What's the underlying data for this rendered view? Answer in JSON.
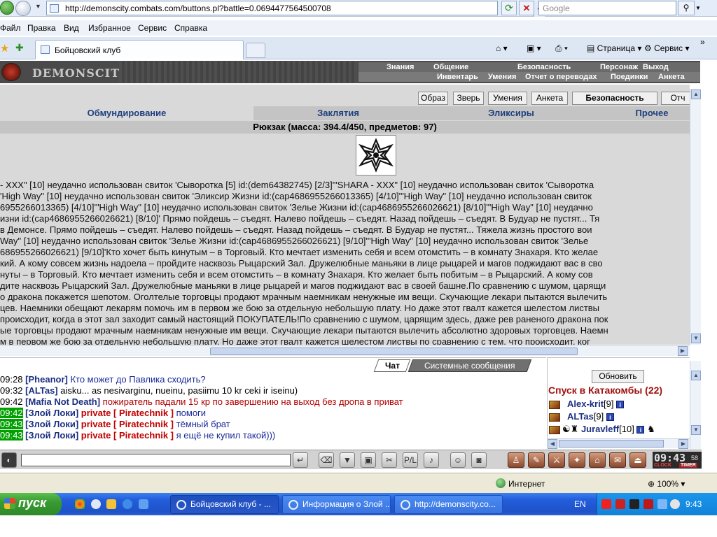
{
  "browser": {
    "url": "http://demonscity.combats.com/buttons.pl?battle=0.0694477564500708",
    "search_placeholder": "Google",
    "menu": [
      "Файл",
      "Правка",
      "Вид",
      "Избранное",
      "Сервис",
      "Справка"
    ],
    "tab_title": "Бойцовский клуб",
    "commands": {
      "page": "Страница",
      "tools": "Сервис"
    },
    "status_zone": "Интернет",
    "zoom": "100%"
  },
  "game": {
    "logo": "DEMONSCITY",
    "nav_top": [
      "Знания",
      "Общение",
      "Безопасность",
      "Персонаж",
      "Выход"
    ],
    "nav_bottom": [
      "Инвентарь",
      "Умения",
      "Отчет о переводах",
      "Поединки",
      "Анкета"
    ],
    "buttons": [
      "Образ",
      "Зверь",
      "Умения",
      "Анкета",
      "Безопасность",
      "Отч"
    ],
    "inventory_tabs": [
      "Обмундирование",
      "Заклятия",
      "Эликсиры",
      "Прочее"
    ],
    "backpack_title": "Рюкзак (масса: 394.4/450, предметов: 97)",
    "log_lines": [
      "- XXX\" [10] неудачно использован свиток 'Сыворотка [5] id:(dem64382745) [2/3]'\"SHARA - XXX\" [10] неудачно использован свиток 'Сыворотка",
      "'High Way\" [10] неудачно использован свиток 'Эликсир Жизни id:(cap4686955266013365) [4/10]'\"High Way\" [10] неудачно использован свиток",
      "6955266013365) [4/10]'\"High Way\" [10] неудачно использован свиток 'Зелье Жизни id:(cap4686955266026621) [8/10]'\"High Way\" [10] неудачно",
      "изни id:(cap4686955266026621) [8/10]' Прямо пойдешь – съедят. Налево пойдешь – съедят. Назад пойдешь – съедят. В Будуар не пустят... Тя",
      " в Демонсе. Прямо пойдешь – съедят. Налево пойдешь – съедят. Назад пойдешь – съедят. В Будуар не пустят... Тяжела жизнь простого вои",
      "   Way\" [10] неудачно использован свиток 'Зелье Жизни id:(cap4686955266026621) [9/10]'\"High Way\" [10] неудачно использован свиток 'Зелье",
      "686955266026621) [9/10]'Кто хочет быть кинутым – в Торговый. Кто мечтает изменить себя и всем отомстить – в комнату Знахаря. Кто желае",
      "кий. А кому совсем жизнь надоела – пройдите насквозь Рыцарский Зал. Дружелюбные маньяки в лице рыцарей и магов поджидают вас в сво",
      "нуты – в Торговый. Кто мечтает изменить себя и всем отомстить – в комнату Знахаря. Кто желает быть побитым – в Рыцарский. А кому сов",
      "дите насквозь Рыцарский Зал. Дружелюбные маньяки в лице рыцарей и магов поджидают вас в своей башне.По сравнению с шумом, царящи",
      "о дракона покажется шепотом. Оголтелые торговцы продают мрачным наемникам ненужные им вещи. Скучающие лекари пытаются вылечить",
      "цев. Наемники обещают лекарям помочь им в первом же бою за отдельную небольшую плату. Но даже этот гвалт кажется шелестом листвы",
      "происходит, когда в этот зал заходит самый настоящий ПОКУПАТЕЛЬ!По сравнению с шумом, царящим здесь, даже рев раненого дракона пок",
      "ые торговцы продают мрачным наемникам ненужные им вещи. Скучающие лекари пытаются вылечить абсолютно здоровых торговцев. Наемн",
      "м в первом же бою за отдельную небольшую плату. Но даже этот гвалт кажется шелестом листвы по сравнению с тем, что происходит, ког"
    ]
  },
  "chat": {
    "tab_chat": "Чат",
    "tab_system": "Системные сообщения",
    "messages": [
      {
        "time": "09:28",
        "nick": "[Pheanor]",
        "private": "",
        "text": " Кто может до Павлика сходить?",
        "hl": false,
        "color": "blue"
      },
      {
        "time": "09:32",
        "nick": "[ALTas]",
        "private": "",
        "text": " aisku... as nesivarginu, nueinu, pasiimu 10 kr ceki ir iseinu)",
        "hl": false,
        "color": "black"
      },
      {
        "time": "09:42",
        "nick": "[Mafia Not Death]",
        "private": "",
        "text": " пожиратель падали 15 кр по завершению на выход без дропа в приват",
        "hl": false,
        "color": "red"
      },
      {
        "time": "09:42",
        "nick": "[Злой Локи]",
        "private": " private [ Piratechnik ]",
        "text": " помоги",
        "hl": true,
        "color": "blue"
      },
      {
        "time": "09:43",
        "nick": "[Злой Локи]",
        "private": " private [ Piratechnik ]",
        "text": " тёмный брат",
        "hl": true,
        "color": "blue"
      },
      {
        "time": "09:43",
        "nick": "[Злой Локи]",
        "private": " private [ Piratechnik ]",
        "text": " я ещё не купил такой)))",
        "hl": true,
        "color": "blue"
      }
    ]
  },
  "online": {
    "refresh": "Обновить",
    "location": "Спуск в Катакомбы (22)",
    "players": [
      {
        "name": "Alex-krit",
        "level": "[9]"
      },
      {
        "name": "ALTas",
        "level": "[9]"
      },
      {
        "name": "Juravleff",
        "level": "[10]"
      }
    ]
  },
  "clock": {
    "time": "09:43",
    "seconds": "58",
    "clock_label": "CLOCK",
    "timer_label": "TIMER"
  },
  "taskbar": {
    "start": "пуск",
    "tasks": [
      "Бойцовский клуб - ...",
      "Информация о Злой ...",
      "http://demonscity.co..."
    ],
    "lang": "EN",
    "time": "9:43"
  }
}
